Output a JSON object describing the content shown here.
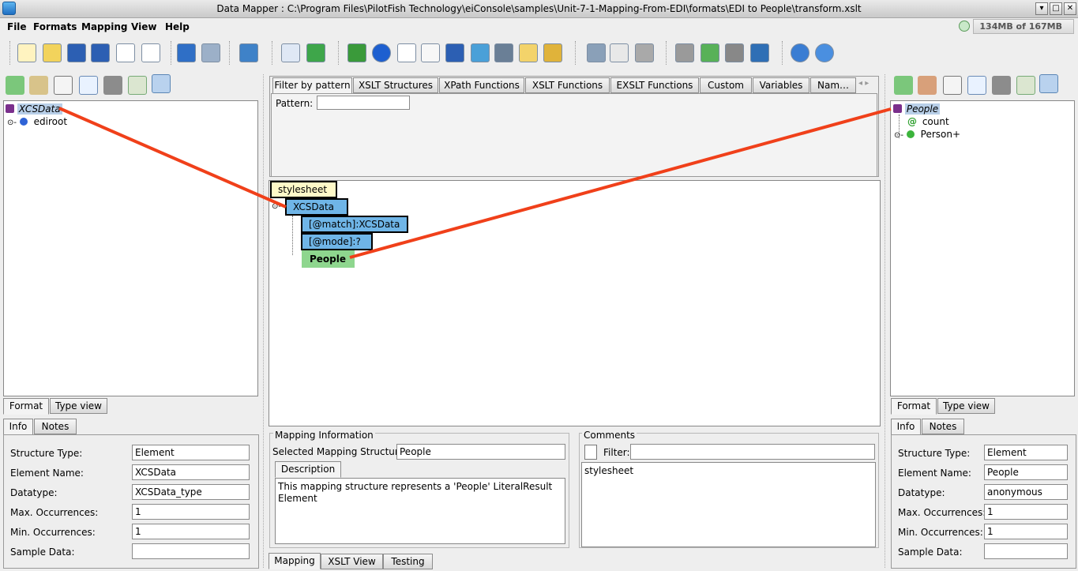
{
  "window": {
    "title": "Data Mapper : C:\\Program Files\\PilotFish Technology\\eiConsole\\samples\\Unit-7-1-Mapping-From-EDI\\formats\\EDI to People\\transform.xslt"
  },
  "menu": [
    "File",
    "Formats",
    "Mapping",
    "View",
    "Help"
  ],
  "memory": "134MB of 167MB",
  "toolbar_icons": [
    "new-file-icon",
    "open-folder-icon",
    "save-icon",
    "save-as-icon",
    "add-file-icon",
    "add-file-alt-icon",
    "undo-icon",
    "redo-icon",
    "import-icon",
    "list-icon",
    "cubes-icon",
    "cube-green-icon",
    "info-circle-icon",
    "edit-icon",
    "document-list-icon",
    "save-disk-icon",
    "tools-icon",
    "zoom-icon",
    "gear-disc-icon",
    "database-icon",
    "cut-icon",
    "copy-icon",
    "paste-icon",
    "ghost-icon",
    "arrow-up-icon",
    "arrow-down-icon",
    "tree-icon",
    "help-icon",
    "about-icon"
  ],
  "left": {
    "tree": {
      "root": "XCSData",
      "child": "ediroot"
    },
    "bottom_tabs": [
      "Format",
      "Type view"
    ],
    "info_tabs": [
      "Info",
      "Notes"
    ],
    "fields": [
      {
        "label": "Structure Type:",
        "value": "Element"
      },
      {
        "label": "Element Name:",
        "value": "XCSData"
      },
      {
        "label": "Datatype:",
        "value": "XCSData_type"
      },
      {
        "label": "Max. Occurrences:",
        "value": "1"
      },
      {
        "label": "Min. Occurrences:",
        "value": "1"
      },
      {
        "label": "Sample Data:",
        "value": ""
      }
    ]
  },
  "center": {
    "tabs": [
      "Filter by pattern",
      "XSLT Structures",
      "XPath Functions",
      "XSLT Functions",
      "EXSLT Functions",
      "Custom",
      "Variables",
      "Nam…"
    ],
    "pattern_label": "Pattern:",
    "pattern_value": "",
    "nodes": {
      "stylesheet": "stylesheet",
      "template": "XCSData",
      "match": "[@match]:XCSData",
      "mode": "[@mode]:?",
      "people": "People"
    },
    "mapping_info": {
      "title": "Mapping Information",
      "selected_label": "Selected Mapping Structure:",
      "selected_value": "People",
      "description_tab": "Description",
      "description": "This mapping structure represents a 'People' LiteralResult Element"
    },
    "comments": {
      "title": "Comments",
      "filter_label": "Filter:",
      "filter_value": "",
      "text": "stylesheet"
    },
    "bottom_tabs": [
      "Mapping",
      "XSLT View",
      "Testing"
    ]
  },
  "right": {
    "tree": {
      "root": "People",
      "attr": "count",
      "child": "Person+"
    },
    "bottom_tabs": [
      "Format",
      "Type view"
    ],
    "info_tabs": [
      "Info",
      "Notes"
    ],
    "fields": [
      {
        "label": "Structure Type:",
        "value": "Element"
      },
      {
        "label": "Element Name:",
        "value": "People"
      },
      {
        "label": "Datatype:",
        "value": "anonymous"
      },
      {
        "label": "Max. Occurrences:",
        "value": "1"
      },
      {
        "label": "Min. Occurrences:",
        "value": "1"
      },
      {
        "label": "Sample Data:",
        "value": ""
      }
    ]
  },
  "colors": {
    "mapping_line": "#f0401a",
    "node_blue": "#6fb5e7",
    "node_green": "#8ed68e",
    "node_yellow": "#fff9c8"
  }
}
